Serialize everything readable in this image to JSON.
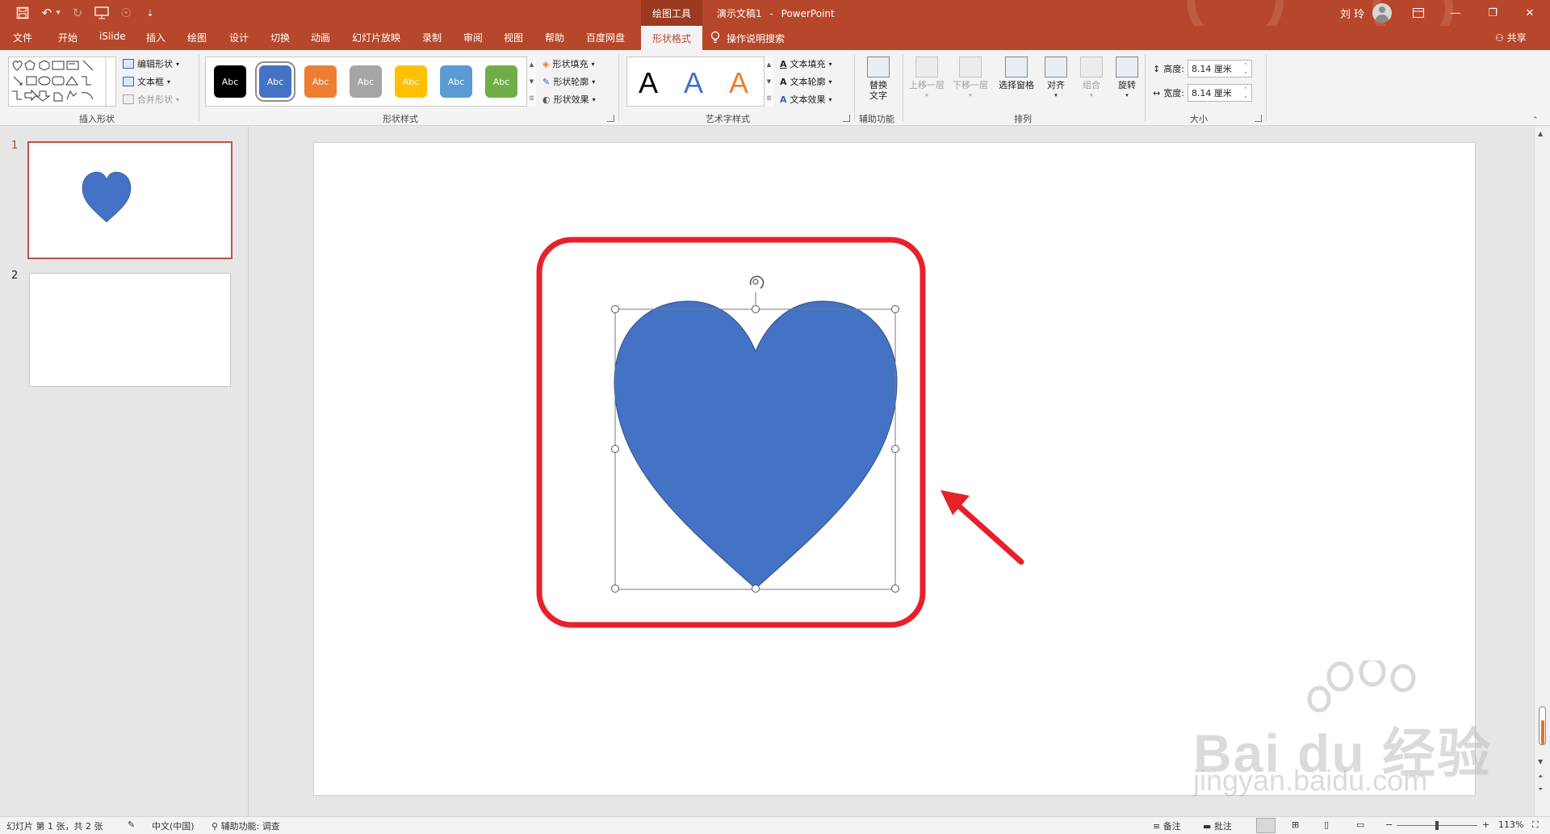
{
  "titlebar": {
    "context_group": "绘图工具",
    "doc_title": "演示文稿1",
    "separator": "-",
    "app_name": "PowerPoint",
    "user": "刘 玲",
    "qat": {
      "customize": "⇣"
    }
  },
  "tabs": [
    "文件",
    "开始",
    "iSlide",
    "插入",
    "绘图",
    "设计",
    "切换",
    "动画",
    "幻灯片放映",
    "录制",
    "审阅",
    "视图",
    "帮助",
    "百度网盘"
  ],
  "active_tab": "形状格式",
  "tell_me": "操作说明搜索",
  "share": "共享",
  "ribbon": {
    "insert_shapes": {
      "edit_shape": "编辑形状",
      "text_box": "文本框",
      "merge_shapes": "合并形状",
      "label": "插入形状"
    },
    "shape_styles": {
      "swatches": [
        {
          "text": "Abc",
          "color": "#000000"
        },
        {
          "text": "Abc",
          "color": "#4472c4"
        },
        {
          "text": "Abc",
          "color": "#ed7d31"
        },
        {
          "text": "Abc",
          "color": "#a5a5a5"
        },
        {
          "text": "Abc",
          "color": "#ffc000"
        },
        {
          "text": "Abc",
          "color": "#5b9bd5"
        },
        {
          "text": "Abc",
          "color": "#70ad47"
        }
      ],
      "fill": "形状填充",
      "outline": "形状轮廓",
      "effects": "形状效果",
      "label": "形状样式"
    },
    "wordart_styles": {
      "letters": [
        {
          "text": "A",
          "color": "#000000"
        },
        {
          "text": "A",
          "color": "#4472c4"
        },
        {
          "text": "A",
          "color": "#ed7d31"
        }
      ],
      "text_fill": "文本填充",
      "text_outline": "文本轮廓",
      "text_effects": "文本效果",
      "label": "艺术字样式"
    },
    "accessibility": {
      "alt_text_line1": "替换",
      "alt_text_line2": "文字",
      "label": "辅助功能"
    },
    "arrange": {
      "bring_forward": "上移一层",
      "send_backward": "下移一层",
      "selection_pane": "选择窗格",
      "align": "对齐",
      "group": "组合",
      "rotate": "旋转",
      "label": "排列"
    },
    "size": {
      "height_label": "高度:",
      "height_value": "8.14 厘米",
      "width_label": "宽度:",
      "width_value": "8.14 厘米",
      "label": "大小"
    }
  },
  "slides": [
    {
      "number": "1",
      "selected": true
    },
    {
      "number": "2",
      "selected": false
    }
  ],
  "shape": {
    "fill": "#4472c4",
    "type": "heart"
  },
  "highlight_color": "#e8202a",
  "status": {
    "slide_info": "幻灯片 第 1 张，共 2 张",
    "language": "中文(中国)",
    "accessibility": "辅助功能: 调查",
    "notes": "备注",
    "comments": "批注",
    "zoom_minus": "−",
    "zoom_plus": "+",
    "zoom": "113%"
  },
  "watermark": {
    "text": "Bai du 经验",
    "url": "jingyan.baidu.com"
  }
}
